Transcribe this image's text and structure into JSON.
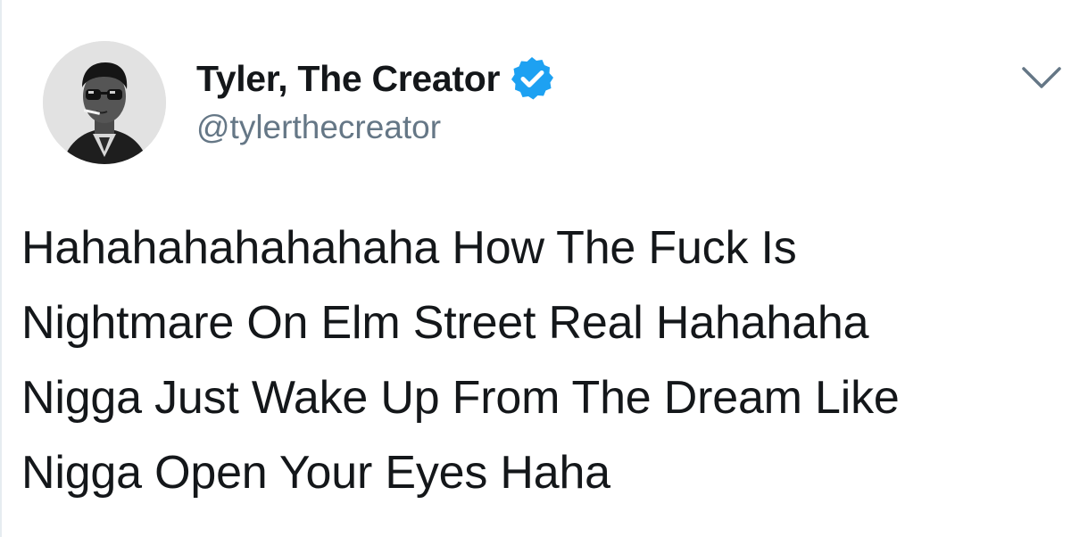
{
  "author": {
    "display_name": "Tyler, The Creator",
    "handle": "@tylerthecreator",
    "verified": true,
    "avatar_icon": "profile-photo"
  },
  "tweet": {
    "text": "Hahahahahahahaha How The Fuck Is\nNightmare On Elm Street Real Hahahaha\nNigga Just Wake Up From The Dream Like\nNigga Open Your Eyes Haha"
  },
  "controls": {
    "menu_icon": "chevron-down-icon"
  },
  "colors": {
    "name": "#14171a",
    "handle": "#657786",
    "verified_badge": "#1da1f2",
    "caret": "#657786",
    "text": "#14171a"
  }
}
